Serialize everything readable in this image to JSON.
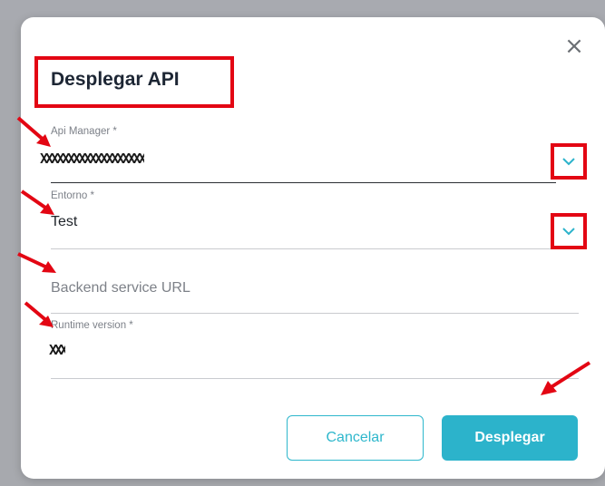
{
  "dialog": {
    "title": "Desplegar API",
    "close_glyph": "×",
    "fields": {
      "api_manager": {
        "label": "Api Manager *",
        "value_redacted": "XXXXXXXXXXXXXXXXXXX"
      },
      "entorno": {
        "label": "Entorno *",
        "value": "Test"
      },
      "backend": {
        "placeholder": "Backend service URL"
      },
      "runtime": {
        "label": "Runtime version *",
        "value_redacted": "XXX"
      }
    },
    "buttons": {
      "cancel": "Cancelar",
      "deploy": "Desplegar"
    }
  },
  "colors": {
    "accent": "#2cb3cb",
    "annotation_red": "#e30613",
    "title": "#1d2634"
  },
  "icons": [
    "close-icon",
    "chevron-down-icon",
    "annotation-arrow"
  ]
}
